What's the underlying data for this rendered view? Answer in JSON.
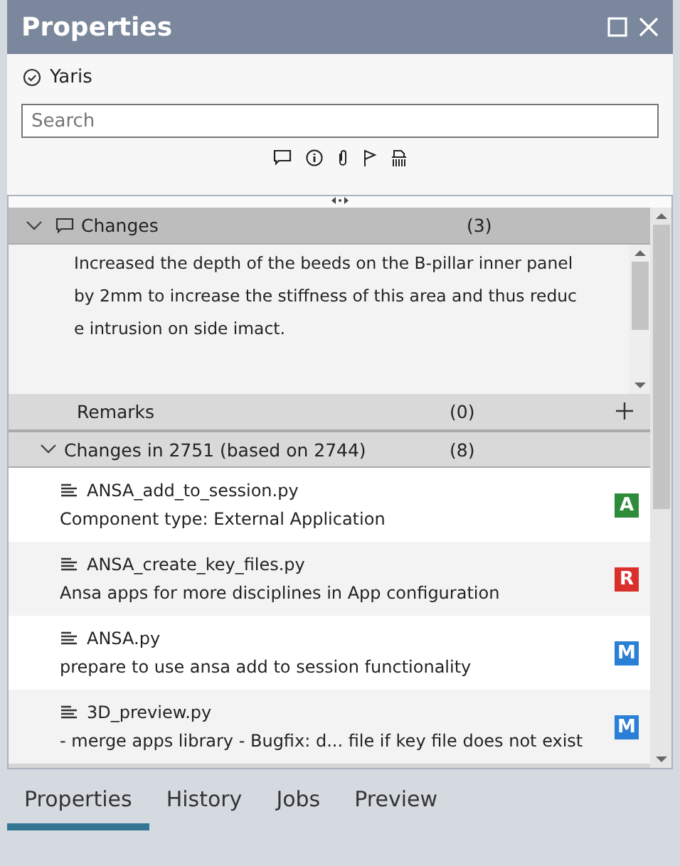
{
  "window": {
    "title": "Properties"
  },
  "item": {
    "name": "Yaris"
  },
  "search": {
    "placeholder": "Search"
  },
  "changes": {
    "title": "Changes",
    "count": "(3)",
    "expanded": true,
    "paragraphs": [
      [
        "Increased the depth of the beeds on the B-pillar inner panel",
        "by 2mm to increase the stiffness of this area and thus reduc",
        "e intrusion on side imact."
      ]
    ]
  },
  "remarks": {
    "title": "Remarks",
    "count": "(0)"
  },
  "changeset": {
    "title": "Changes in 2751 (based on 2744)",
    "count": "(8)",
    "expanded": true,
    "files": [
      {
        "name": "ANSA_add_to_session.py",
        "message": "Component type: External Application",
        "status": "A",
        "color": "#2e8b3a"
      },
      {
        "name": "ANSA_create_key_files.py",
        "message": "Ansa apps for more disciplines in App configuration",
        "status": "R",
        "color": "#d9302c"
      },
      {
        "name": "ANSA.py",
        "message": "prepare to use ansa add to session functionality",
        "status": "M",
        "color": "#2a7fd6"
      },
      {
        "name": "3D_preview.py",
        "message": "- merge apps library - Bugfix: d... file if key file does not exist",
        "status": "M",
        "color": "#2a7fd6"
      }
    ]
  },
  "tabs": [
    {
      "label": "Properties",
      "selected": true
    },
    {
      "label": "History",
      "selected": false
    },
    {
      "label": "Jobs",
      "selected": false
    },
    {
      "label": "Preview",
      "selected": false
    }
  ]
}
